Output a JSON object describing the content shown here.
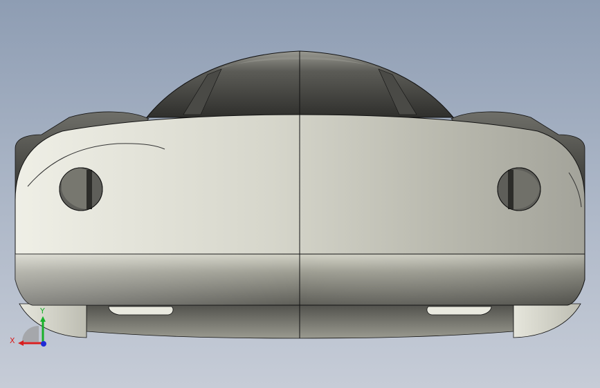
{
  "triad": {
    "x_label": "X",
    "y_label": "Y",
    "x_color": "#d81e1e",
    "y_color": "#17b02a",
    "z_color": "#1f2bd6"
  },
  "colors": {
    "body_light": "#ecece2",
    "body_mid": "#c8c8bc",
    "body_dark": "#8f8f86",
    "glass_dark": "#3b3b38",
    "glass_mid": "#6f6f6a",
    "edge": "#111111"
  }
}
